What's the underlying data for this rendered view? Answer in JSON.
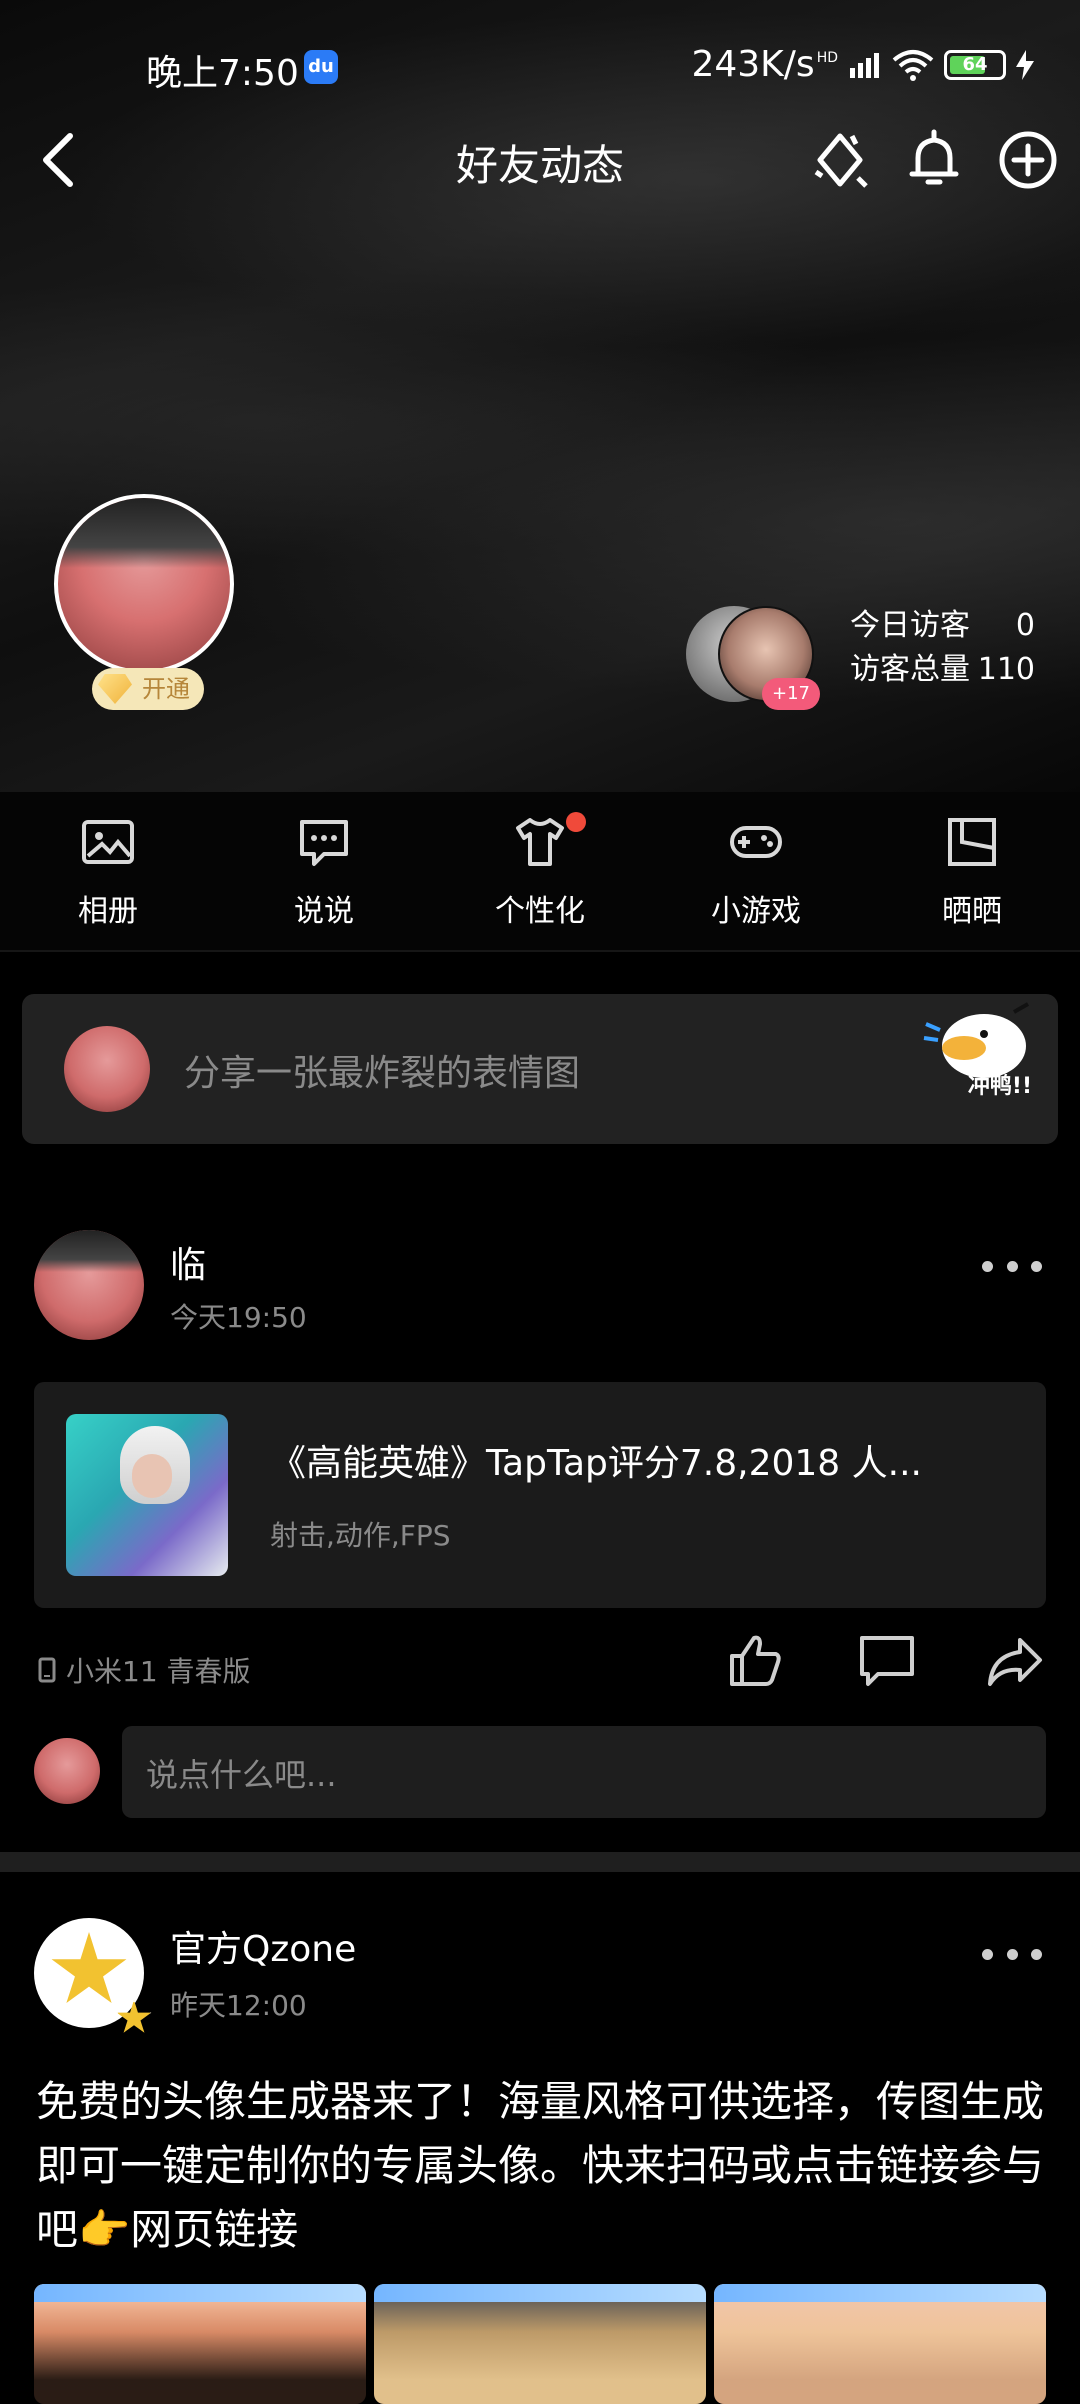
{
  "status_bar": {
    "time": "晚上7:50",
    "app_badge": "du",
    "net_speed": "243K/s",
    "net_label": "HD",
    "battery": "64"
  },
  "header": {
    "title": "好友动态"
  },
  "profile": {
    "vip_badge": "开通",
    "visitors_more": "+17",
    "today_visitors_label": "今日访客",
    "today_visitors_value": "0",
    "total_visitors_label": "访客总量",
    "total_visitors_value": "110"
  },
  "quick_nav": {
    "items": [
      {
        "label": "相册",
        "icon": "photo-album-icon"
      },
      {
        "label": "说说",
        "icon": "chat-bubble-icon"
      },
      {
        "label": "个性化",
        "icon": "tshirt-icon"
      },
      {
        "label": "小游戏",
        "icon": "gamepad-icon"
      },
      {
        "label": "晒晒",
        "icon": "frame-icon"
      }
    ]
  },
  "share_box": {
    "placeholder": "分享一张最炸裂的表情图",
    "sticker_text": "冲鸭!!"
  },
  "post1": {
    "author": "临",
    "time": "今天19:50",
    "card_title": "《高能英雄》TapTap评分7.8,2018 人...",
    "card_tags": "射击,动作,FPS",
    "device": "小米11 青春版",
    "comment_placeholder": "说点什么吧..."
  },
  "post2": {
    "author": "官方Qzone",
    "time": "昨天12:00",
    "text": "免费的头像生成器来了！海量风格可供选择，传图生成即可一键定制你的专属头像。快来扫码或点击链接参与吧👉网页链接"
  },
  "colors": {
    "background": "#000000",
    "accent_red": "#f04a3a",
    "muted_text": "#8a8a8a",
    "battery_green": "#5fd35a"
  }
}
